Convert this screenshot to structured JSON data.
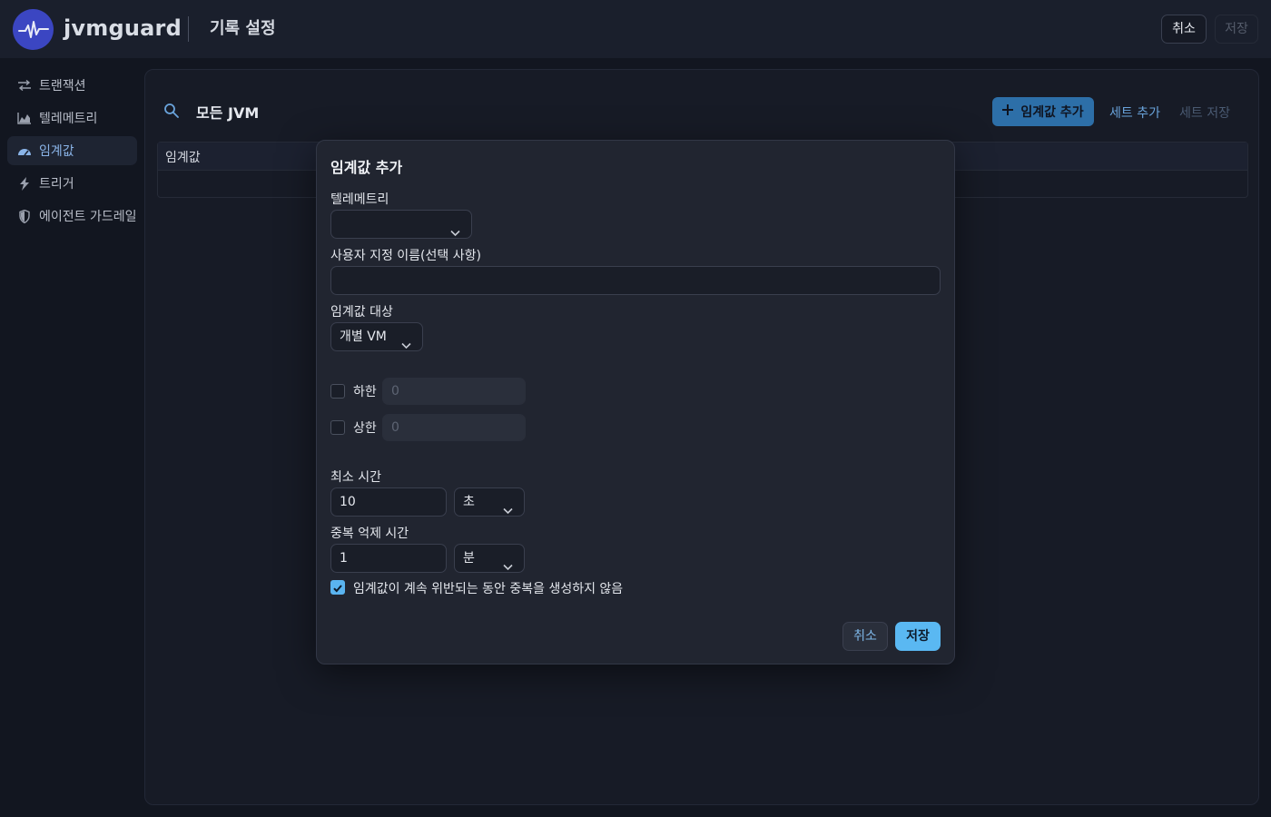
{
  "header": {
    "brand": "jvmguard",
    "title": "기록 설정",
    "cancel_label": "취소",
    "save_label": "저장"
  },
  "sidebar": {
    "items": [
      {
        "label": "트랜잭션",
        "icon": "transactions-icon"
      },
      {
        "label": "텔레메트리",
        "icon": "telemetry-chart-icon"
      },
      {
        "label": "임계값",
        "icon": "gauge-icon",
        "active": true
      },
      {
        "label": "트리거",
        "icon": "lightning-icon"
      },
      {
        "label": "에이전트 가드레일",
        "icon": "shield-icon"
      }
    ]
  },
  "main": {
    "title": "모든 JVM",
    "add_threshold_label": "임계값 추가",
    "add_set_label": "세트 추가",
    "save_set_label": "세트 저장",
    "table": {
      "columns": [
        "임계값"
      ]
    }
  },
  "modal": {
    "title": "임계값 추가",
    "telemetry_label": "텔레메트리",
    "telemetry_value": "",
    "custom_name_label": "사용자 지정 이름(선택 사항)",
    "custom_name_value": "",
    "target_label": "임계값 대상",
    "target_value": "개별 VM",
    "lower_label": "하한",
    "lower_placeholder": "0",
    "upper_label": "상한",
    "upper_placeholder": "0",
    "min_time_label": "최소 시간",
    "min_time_value": "10",
    "min_time_unit": "초",
    "dedup_label": "중복 억제 시간",
    "dedup_value": "1",
    "dedup_unit": "분",
    "no_dup_label": "임계값이 계속 위반되는 동안 중복을 생성하지 않음",
    "no_dup_checked": true,
    "cancel_label": "취소",
    "save_label": "저장"
  },
  "colors": {
    "accent": "#5ab8f2",
    "primary_button": "#2d6fa8",
    "background": "#121620",
    "logo": "#3b46c2"
  }
}
